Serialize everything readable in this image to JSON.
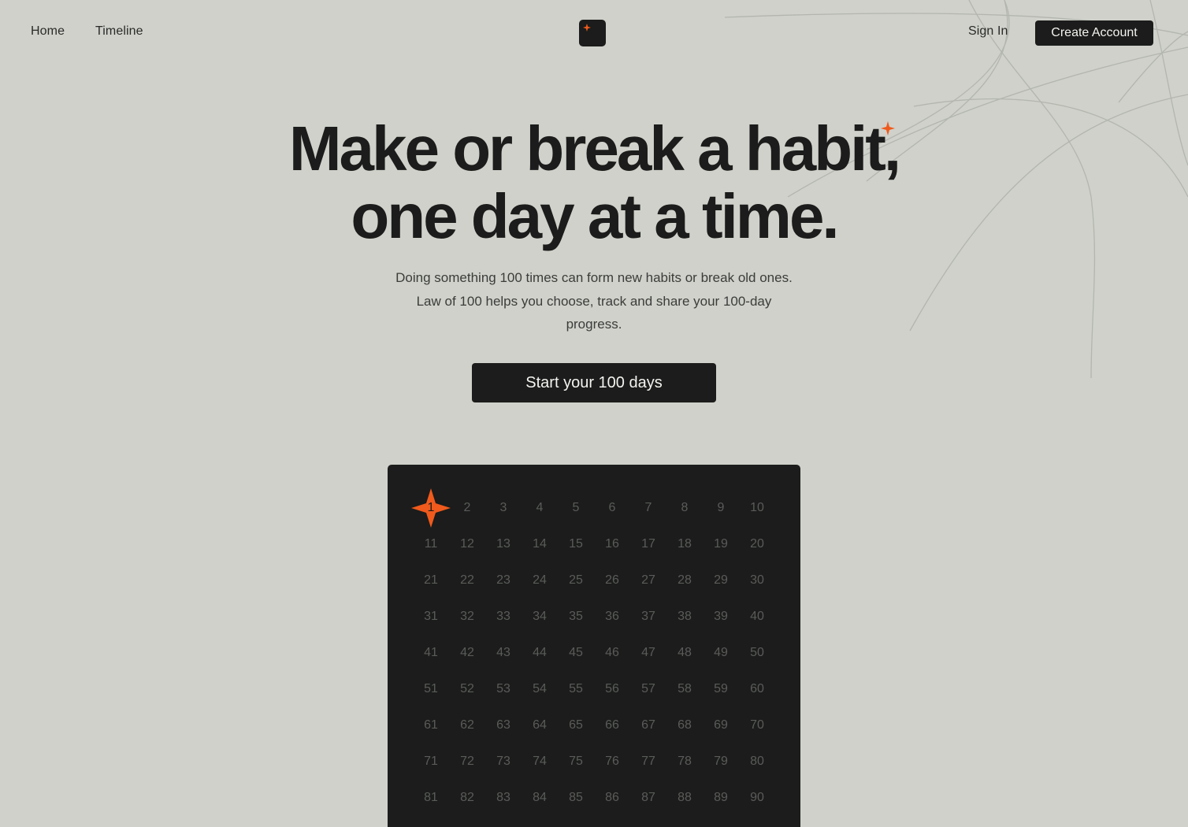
{
  "nav": {
    "home_label": "Home",
    "timeline_label": "Timeline",
    "sign_in_label": "Sign In",
    "create_account_label": "Create Account",
    "logo_icon": "sparkle-icon"
  },
  "hero": {
    "headline_line1": "Make or break a habit,",
    "headline_line2": "one day at a time.",
    "subtitle": "Doing something 100 times can form new habits or break old ones. Law of 100 helps you choose, track and share your 100-day progress.",
    "cta_label": "Start your 100 days"
  },
  "day_grid": {
    "days": [
      "1",
      "2",
      "3",
      "4",
      "5",
      "6",
      "7",
      "8",
      "9",
      "10",
      "11",
      "12",
      "13",
      "14",
      "15",
      "16",
      "17",
      "18",
      "19",
      "20",
      "21",
      "22",
      "23",
      "24",
      "25",
      "26",
      "27",
      "28",
      "29",
      "30",
      "31",
      "32",
      "33",
      "34",
      "35",
      "36",
      "37",
      "38",
      "39",
      "40",
      "41",
      "42",
      "43",
      "44",
      "45",
      "46",
      "47",
      "48",
      "49",
      "50",
      "51",
      "52",
      "53",
      "54",
      "55",
      "56",
      "57",
      "58",
      "59",
      "60",
      "61",
      "62",
      "63",
      "64",
      "65",
      "66",
      "67",
      "68",
      "69",
      "70",
      "71",
      "72",
      "73",
      "74",
      "75",
      "76",
      "77",
      "78",
      "79",
      "80",
      "81",
      "82",
      "83",
      "84",
      "85",
      "86",
      "87",
      "88",
      "89",
      "90"
    ],
    "active_day": "1",
    "active_icon": "four-point-star-icon"
  },
  "colors": {
    "background": "#cfd1ca",
    "dark": "#1b1c1b",
    "accent": "#f05a1c",
    "grid_number": "#5a5c59"
  }
}
